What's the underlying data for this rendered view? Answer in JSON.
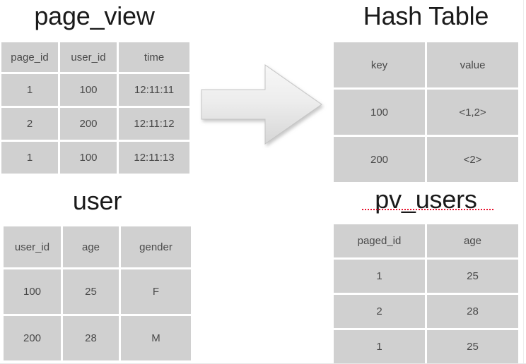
{
  "slide": {
    "background_color": "#ffffff",
    "cell_background_color": "#d0d0d0",
    "cell_text_color": "#4a4a4a",
    "title_text_color": "#1a1a1a",
    "spellcheck_underline_color": "#e8112d"
  },
  "arrow": {
    "name": "right-block-arrow",
    "direction": "right",
    "fill_top_color": "#f4f4f4",
    "fill_bottom_color": "#d9d9d9",
    "stroke_color": "#bfbfbf"
  },
  "tables": [
    {
      "id": "page_view",
      "title": "page_view",
      "title_spellcheck_error": false,
      "columns": [
        "page_id",
        "user_id",
        "time"
      ],
      "rows": [
        [
          "1",
          "100",
          "12:11:11"
        ],
        [
          "2",
          "200",
          "12:11:12"
        ],
        [
          "1",
          "100",
          "12:11:13"
        ]
      ]
    },
    {
      "id": "hash_table",
      "title": "Hash Table",
      "title_spellcheck_error": false,
      "columns": [
        "key",
        "value"
      ],
      "rows": [
        [
          "100",
          "<1,2>"
        ],
        [
          "200",
          "<2>"
        ]
      ]
    },
    {
      "id": "user",
      "title": "user",
      "title_spellcheck_error": false,
      "columns": [
        "user_id",
        "age",
        "gender"
      ],
      "rows": [
        [
          "100",
          "25",
          "F"
        ],
        [
          "200",
          "28",
          "M"
        ]
      ]
    },
    {
      "id": "pv_users",
      "title": "pv_users",
      "title_spellcheck_error": true,
      "columns": [
        "paged_id",
        "age"
      ],
      "rows": [
        [
          "1",
          "25"
        ],
        [
          "2",
          "28"
        ],
        [
          "1",
          "25"
        ]
      ]
    }
  ]
}
